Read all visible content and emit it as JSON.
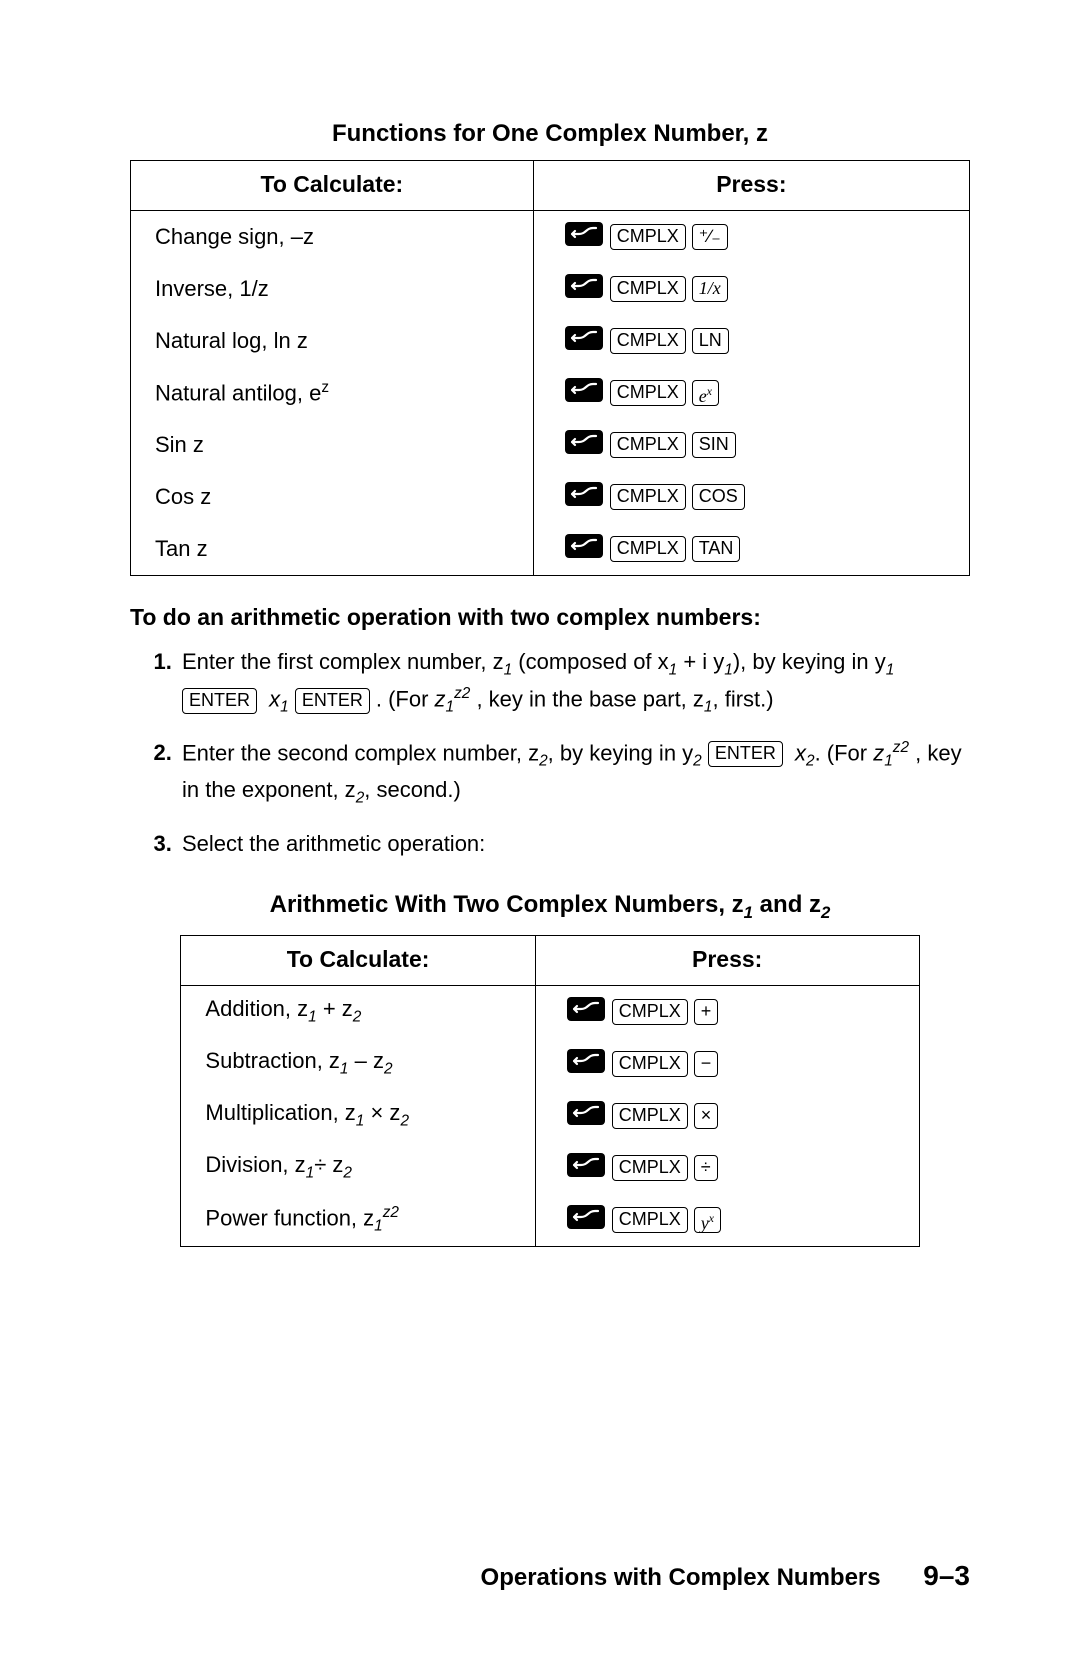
{
  "table1": {
    "title": "Functions for One Complex Number, z",
    "header_left": "To Calculate:",
    "header_right": "Press:",
    "rows": [
      {
        "calc": "Change sign, –z",
        "keys": [
          "SHIFT",
          "CMPLX",
          "±"
        ]
      },
      {
        "calc": "Inverse, 1/z",
        "keys": [
          "SHIFT",
          "CMPLX",
          "1/x"
        ]
      },
      {
        "calc": "Natural log, ln z",
        "keys": [
          "SHIFT",
          "CMPLX",
          "LN"
        ]
      },
      {
        "calc": "Natural antilog, e^z",
        "keys": [
          "SHIFT",
          "CMPLX",
          "e^x"
        ]
      },
      {
        "calc": "Sin z",
        "keys": [
          "SHIFT",
          "CMPLX",
          "SIN"
        ]
      },
      {
        "calc": "Cos z",
        "keys": [
          "SHIFT",
          "CMPLX",
          "COS"
        ]
      },
      {
        "calc": "Tan z",
        "keys": [
          "SHIFT",
          "CMPLX",
          "TAN"
        ]
      }
    ]
  },
  "arith_heading": "To do an arithmetic operation with two complex numbers:",
  "steps": {
    "s1_a": "Enter the first complex number, z",
    "s1_b": " (composed of x",
    "s1_c": " + i y",
    "s1_d": "), by keying in y",
    "s1_e": " x",
    "s1_f": ". (For ",
    "s1_g": " , key in the base part, z",
    "s1_h": ", first.)",
    "s2_a": "Enter the second complex number, z",
    "s2_b": ", by keying in y",
    "s2_c": " x",
    "s2_d": ". (For ",
    "s2_e": " , key in the exponent, z",
    "s2_f": ", second.)",
    "s3": "Select the arithmetic operation:"
  },
  "key_enter": "ENTER",
  "table2": {
    "title_a": "Arithmetic With Two Complex Numbers, z",
    "title_b": " and z",
    "header_left": "To Calculate:",
    "header_right": "Press:",
    "rows": [
      {
        "calc_a": "Addition, z",
        "calc_op": " + z",
        "keys": [
          "SHIFT",
          "CMPLX",
          "+"
        ]
      },
      {
        "calc_a": "Subtraction, z",
        "calc_op": " – z",
        "keys": [
          "SHIFT",
          "CMPLX",
          "−"
        ]
      },
      {
        "calc_a": "Multiplication, z",
        "calc_op": " × z",
        "keys": [
          "SHIFT",
          "CMPLX",
          "×"
        ]
      },
      {
        "calc_a": "Division, z",
        "calc_op": "÷ z",
        "keys": [
          "SHIFT",
          "CMPLX",
          "÷"
        ]
      },
      {
        "calc_a": "Power function,  z",
        "calc_op": "",
        "keys": [
          "SHIFT",
          "CMPLX",
          "y^x"
        ]
      }
    ]
  },
  "footer": {
    "title": "Operations with Complex Numbers",
    "page": "9–3"
  }
}
